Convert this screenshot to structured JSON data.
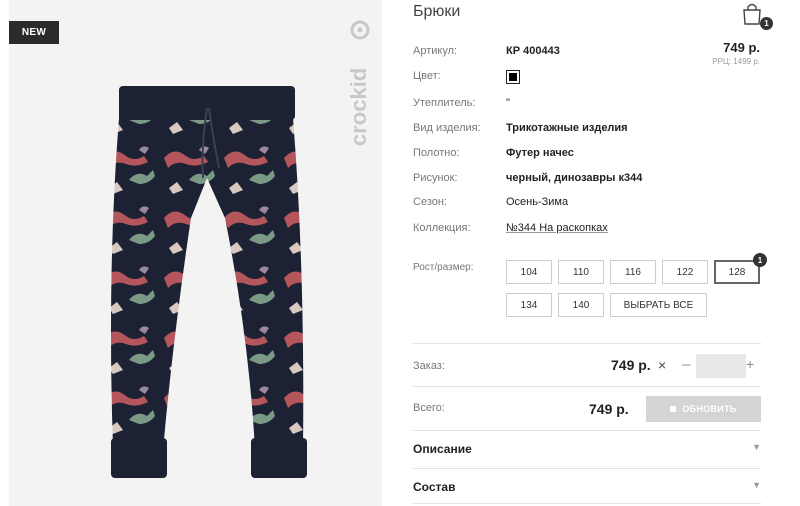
{
  "product": {
    "badge": "NEW",
    "brand": "crockid",
    "title": "Брюки",
    "price": "749 р.",
    "rrp": "РРЦ: 1499 р."
  },
  "cart": {
    "count": "1",
    "icon": "shopping-bag-icon"
  },
  "specs": {
    "article_label": "Артикул:",
    "article_value": "КР 400443",
    "color_label": "Цвет:",
    "color_swatch": "#000000",
    "insulation_label": "Утеплитель:",
    "insulation_value": "\"",
    "type_label": "Вид изделия:",
    "type_value": "Трикотажные изделия",
    "fabric_label": "Полотно:",
    "fabric_value": "Футер начес",
    "print_label": "Рисунок:",
    "print_value": "черный, динозавры к344",
    "season_label": "Сезон:",
    "season_value": "Осень-Зима",
    "collection_label": "Коллекция:",
    "collection_value": "№344 На раскопках"
  },
  "sizes": {
    "label": "Рост/размер:",
    "options": [
      "104",
      "110",
      "116",
      "122",
      "128",
      "134",
      "140"
    ],
    "selected": "128",
    "selected_count": "1",
    "select_all": "ВЫБРАТЬ ВСЕ"
  },
  "order": {
    "label": "Заказ:",
    "price": "749 р.",
    "qty": "",
    "minus": "–",
    "plus": "+",
    "x": "×"
  },
  "total": {
    "label": "Всего:",
    "price": "749 р.",
    "update_label": "ОБНОВИТЬ"
  },
  "accordion": {
    "description": "Описание",
    "composition": "Состав"
  }
}
